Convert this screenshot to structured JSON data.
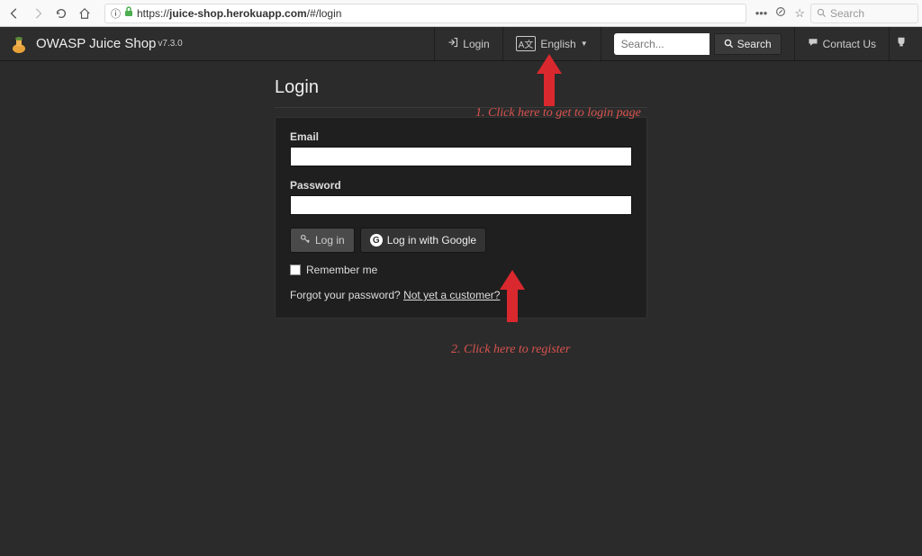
{
  "browser": {
    "url_prefix": "https://",
    "url_domain": "juice-shop.herokuapp.com",
    "url_path": "/#/login",
    "search_placeholder": "Search"
  },
  "navbar": {
    "app_title": "OWASP Juice Shop",
    "app_version": "v7.3.0",
    "login_label": "Login",
    "language_label": "English",
    "search_placeholder": "Search...",
    "search_btn": "Search",
    "contact_label": "Contact Us"
  },
  "login": {
    "heading": "Login",
    "email_label": "Email",
    "password_label": "Password",
    "login_btn": "Log in",
    "google_btn": "Log in with Google",
    "remember_label": "Remember me",
    "forgot_text": "Forgot your password? ",
    "register_link": "Not yet a customer?"
  },
  "annotations": {
    "step1": "1. Click here to get to login page",
    "step2": "2. Click here to register"
  }
}
